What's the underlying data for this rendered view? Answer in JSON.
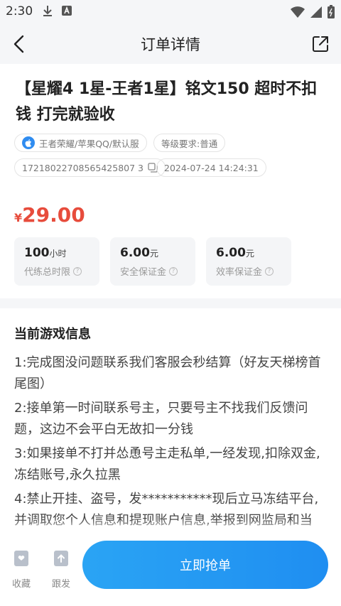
{
  "status_bar": {
    "time": "2:30"
  },
  "nav": {
    "title": "订单详情"
  },
  "order": {
    "title": "【星耀4 1星-王者1星】铭文150 超时不扣钱 打完就验收",
    "game_tag": "王者荣耀/苹果QQ/默认服",
    "level_tag": "等级要求:普通",
    "order_no": "17218022708565425807 3",
    "order_time": "2024-07-24 14:24:31",
    "currency": "¥",
    "price": "29.00"
  },
  "info_boxes": [
    {
      "value": "100",
      "unit": "小时",
      "label": "代练总时限"
    },
    {
      "value": "6.00",
      "unit": "元",
      "label": "安全保证金"
    },
    {
      "value": "6.00",
      "unit": "元",
      "label": "效率保证金"
    }
  ],
  "game_info": {
    "title": "当前游戏信息",
    "lines": [
      "1:完成图没问题联系我们客服会秒结算（好友天梯榜首尾图）",
      "2:接单第一时间联系号主，只要号主不找我们反馈问题，这边不会平白无故扣一分钱",
      "3:如果接单不打并怂恿号主走私单,一经发现,扣除双金,冻结账号,永久拉黑",
      "4:禁止开挂、盗号，发***********现后立马冻结平台,并调取您个人信息和提现账户信息,举报到网监局和当"
    ]
  },
  "bottom_bar": {
    "favorite_label": "收藏",
    "follow_label": "跟发",
    "grab_label": "立即抢单"
  },
  "colors": {
    "accent": "#1f8ef1",
    "price": "#e74c3c",
    "background": "#f5f6f8"
  }
}
